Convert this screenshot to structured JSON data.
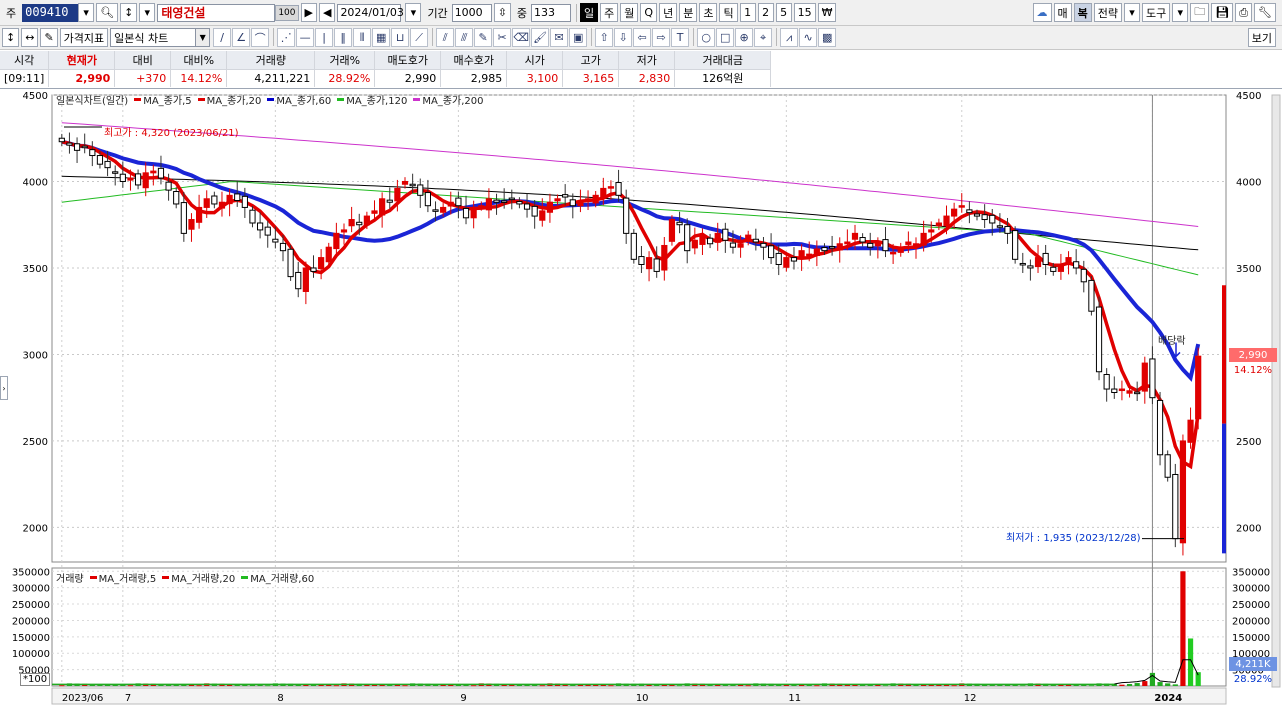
{
  "toolbar1": {
    "stock_prefix": "주",
    "stock_code": "009410",
    "stock_name": "태영건설",
    "name_badge": "100",
    "date": "2024/01/03",
    "period_label": "기간",
    "period_value": "1000",
    "overlap_label": "중",
    "overlap_value": "133",
    "interval_buttons": [
      "일",
      "주",
      "월",
      "Q",
      "년",
      "분",
      "초",
      "틱",
      "1",
      "2",
      "5",
      "15",
      "₩"
    ],
    "right_buttons": [
      "매",
      "복",
      "전략",
      "도구"
    ]
  },
  "toolbar2": {
    "indicator_button": "가격지표",
    "chart_type_select": "일본식 차트",
    "view_button": "보기"
  },
  "quote": {
    "headers": [
      "시각",
      "현재가",
      "대비",
      "대비%",
      "거래량",
      "거래%",
      "매도호가",
      "매수호가",
      "시가",
      "고가",
      "저가",
      "거래대금"
    ],
    "values": [
      "[09:11]",
      "2,990",
      "+370",
      "14.12%",
      "4,211,221",
      "28.92%",
      "2,990",
      "2,985",
      "3,100",
      "3,165",
      "2,830",
      "126억원"
    ]
  },
  "legend_price": {
    "title": "일본식차트(일간)",
    "items": [
      {
        "label": "MA_종가,5",
        "color": "#e00000"
      },
      {
        "label": "MA_종가,20",
        "color": "#e00000"
      },
      {
        "label": "MA_종가,60",
        "color": "#0000cc"
      },
      {
        "label": "MA_종가,120",
        "color": "#22bb22"
      },
      {
        "label": "MA_종가,200",
        "color": "#cc33cc"
      }
    ]
  },
  "legend_volume": {
    "title": "거래량",
    "items": [
      {
        "label": "MA_거래량,5",
        "color": "#e00000"
      },
      {
        "label": "MA_거래량,20",
        "color": "#e00000"
      },
      {
        "label": "MA_거래량,60",
        "color": "#22bb22"
      }
    ]
  },
  "annotations": {
    "high": "최고가 : 4,320 (2023/06/21)",
    "low": "최저가 : 1,935 (2023/12/28)",
    "dividend": "배당락"
  },
  "right_axis": {
    "price_tag": "2,990",
    "change_tag": "14.12%",
    "volume_tag": "4,211K",
    "volume_pct_tag": "28.92%",
    "volume_unit": "*100"
  },
  "chart_data": [
    {
      "type": "candlestick",
      "title": "일본식차트(일간)",
      "yticks": [
        2000,
        2500,
        3000,
        3500,
        4000,
        4500
      ],
      "ylim": [
        1800,
        4500
      ],
      "x_ticks": [
        "2023/06",
        "7",
        "8",
        "9",
        "10",
        "11",
        "12",
        "2024"
      ],
      "close": [
        4230,
        4210,
        4180,
        4200,
        4150,
        4100,
        4080,
        4050,
        4000,
        4020,
        3980,
        4050,
        4060,
        4020,
        3950,
        3870,
        3700,
        3780,
        3850,
        3900,
        3870,
        3880,
        3920,
        3890,
        3850,
        3760,
        3720,
        3690,
        3650,
        3600,
        3450,
        3380,
        3500,
        3480,
        3560,
        3620,
        3700,
        3720,
        3780,
        3750,
        3800,
        3830,
        3900,
        3880,
        3960,
        4000,
        3980,
        3920,
        3860,
        3830,
        3850,
        3880,
        3860,
        3790,
        3840,
        3860,
        3900,
        3880,
        3880,
        3900,
        3870,
        3840,
        3800,
        3830,
        3880,
        3900,
        3910,
        3860,
        3880,
        3900,
        3920,
        3960,
        3970,
        3920,
        3700,
        3550,
        3520,
        3560,
        3480,
        3630,
        3780,
        3750,
        3600,
        3660,
        3680,
        3640,
        3700,
        3660,
        3620,
        3640,
        3690,
        3650,
        3620,
        3560,
        3520,
        3560,
        3540,
        3600,
        3580,
        3610,
        3600,
        3620,
        3640,
        3650,
        3700,
        3650,
        3620,
        3640,
        3600,
        3590,
        3620,
        3650,
        3640,
        3700,
        3720,
        3760,
        3800,
        3840,
        3860,
        3820,
        3800,
        3780,
        3760,
        3740,
        3700,
        3550,
        3520,
        3500,
        3560,
        3520,
        3480,
        3520,
        3560,
        3500,
        3420,
        3250,
        2900,
        2800,
        2780,
        2800,
        2790,
        2780,
        2950,
        2750,
        2420,
        2290,
        1935,
        2500,
        2620,
        2990
      ],
      "ma5_last": 2660,
      "ma20_last": 3060,
      "ma60_last": 3460,
      "ma120_last": 3640,
      "ma200_last": 3740
    },
    {
      "type": "bar",
      "title": "거래량",
      "yticks": [
        50000,
        100000,
        150000,
        200000,
        250000,
        300000,
        350000
      ],
      "ylim": [
        0,
        360000
      ],
      "last_values": [
        4000,
        6000,
        9000,
        15000,
        40000,
        12000,
        8000,
        5000,
        350000,
        145000,
        42112
      ]
    }
  ]
}
